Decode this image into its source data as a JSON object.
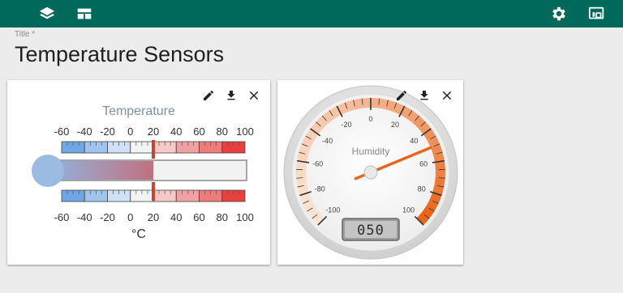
{
  "toolbar": {
    "left_icons": [
      "layers-icon",
      "dashboard-icon"
    ],
    "right_icons": [
      "gear-icon",
      "display-icon"
    ]
  },
  "page": {
    "title_label": "Title *",
    "title": "Temperature Sensors"
  },
  "cards": [
    {
      "type": "thermometer",
      "label": "Temperature",
      "unit": "°C",
      "min": -60,
      "max": 100,
      "value": 20,
      "scale_labels": [
        "-60",
        "-40",
        "-20",
        "0",
        "20",
        "40",
        "60",
        "80",
        "100"
      ],
      "tools": [
        "edit-icon",
        "download-icon",
        "close-icon"
      ]
    },
    {
      "type": "gauge",
      "label": "Humidity",
      "min": -100,
      "max": 100,
      "value": 50,
      "display": "050",
      "scale_labels": [
        "-100",
        "-80",
        "-60",
        "-40",
        "-20",
        "0",
        "20",
        "40",
        "60",
        "80",
        "100"
      ],
      "tools": [
        "edit-icon",
        "download-icon",
        "close-icon"
      ]
    }
  ],
  "colors": {
    "topbar": "#00695c",
    "thermo_cold": "#7aaee6",
    "thermo_hot": "#e8403f",
    "gauge_accent": "#e8661c"
  }
}
